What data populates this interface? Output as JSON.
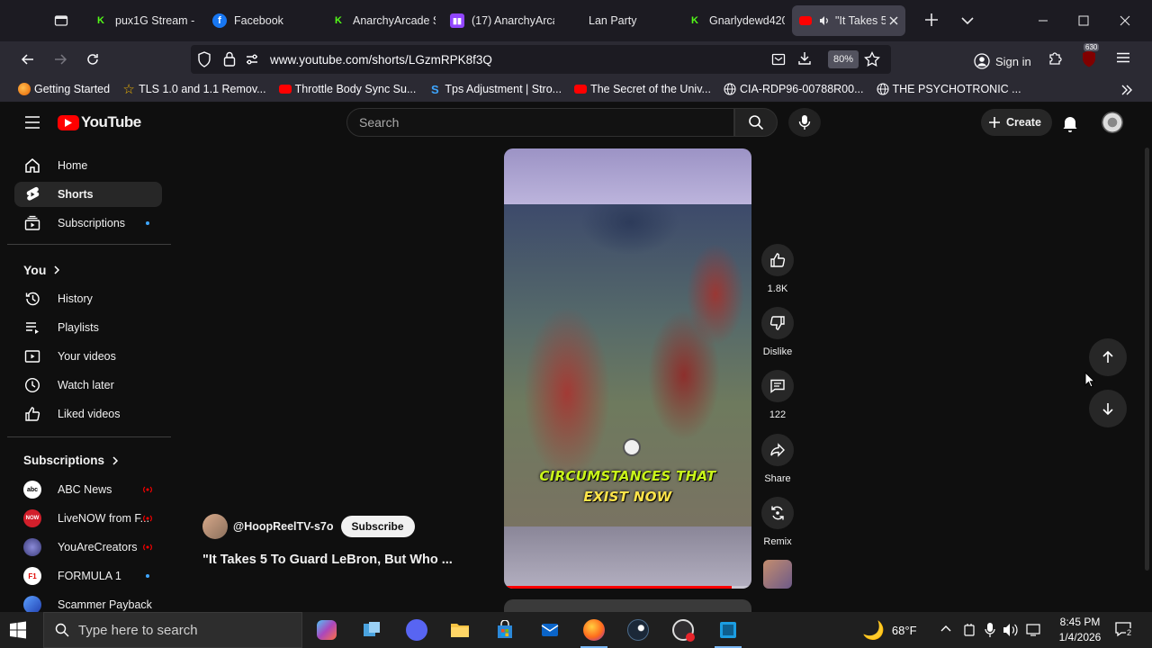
{
  "browser": {
    "tabs": [
      {
        "title": "pux1G Stream - ",
        "favicon": "kick-icon",
        "color": "#53fc18"
      },
      {
        "title": "Facebook",
        "favicon": "facebook-icon",
        "color": "#1877f2"
      },
      {
        "title": "AnarchyArcade S",
        "favicon": "kick-icon",
        "color": "#53fc18"
      },
      {
        "title": "(17) AnarchyArca",
        "favicon": "twitch-icon",
        "color": "#9146ff"
      },
      {
        "title": "Lan Party",
        "favicon": "",
        "color": ""
      },
      {
        "title": "Gnarlydewd420 ",
        "favicon": "kick-icon",
        "color": "#53fc18"
      },
      {
        "title": "\"It Takes 5",
        "favicon": "youtube-icon",
        "color": "#ff0000",
        "active": true
      }
    ],
    "url": "www.youtube.com/shorts/LGzmRPK8f3Q",
    "zoom": "80%",
    "sign_in": "Sign in",
    "extension_badge": "630",
    "bookmarks": [
      {
        "label": "Getting Started",
        "icon": "firefox-icon"
      },
      {
        "label": "TLS 1.0 and 1.1 Remov...",
        "icon": "star-icon"
      },
      {
        "label": "Throttle Body Sync Su...",
        "icon": "youtube-icon"
      },
      {
        "label": "Tps Adjustment | Stro...",
        "icon": "s-icon"
      },
      {
        "label": "The Secret of the Univ...",
        "icon": "youtube-icon"
      },
      {
        "label": "CIA-RDP96-00788R00...",
        "icon": "globe-icon"
      },
      {
        "label": "THE PSYCHOTRONIC ...",
        "icon": "globe-icon"
      }
    ]
  },
  "youtube": {
    "logo_text": "YouTube",
    "search_placeholder": "Search",
    "create_label": "Create",
    "sidebar": {
      "main": [
        {
          "label": "Home",
          "icon": "home-icon"
        },
        {
          "label": "Shorts",
          "icon": "shorts-icon",
          "active": true
        },
        {
          "label": "Subscriptions",
          "icon": "subscriptions-icon",
          "dot": true
        }
      ],
      "you_header": "You",
      "you": [
        {
          "label": "History",
          "icon": "history-icon"
        },
        {
          "label": "Playlists",
          "icon": "playlists-icon"
        },
        {
          "label": "Your videos",
          "icon": "your-videos-icon"
        },
        {
          "label": "Watch later",
          "icon": "watch-later-icon"
        },
        {
          "label": "Liked videos",
          "icon": "liked-videos-icon"
        }
      ],
      "subscriptions_header": "Subscriptions",
      "subscriptions": [
        {
          "label": "ABC News",
          "status": "live",
          "avatar_color": "#ffffff",
          "avatar_text": "abc"
        },
        {
          "label": "LiveNOW from F...",
          "status": "live",
          "avatar_color": "#d21f2b",
          "avatar_text": "NOW"
        },
        {
          "label": "YouAreCreators",
          "status": "live",
          "avatar_color": "#5f5fa8",
          "avatar_text": ""
        },
        {
          "label": "FORMULA 1",
          "status": "dot",
          "avatar_color": "#e10600",
          "avatar_text": "F1"
        },
        {
          "label": "Scammer Payback",
          "status": "",
          "avatar_color": "#3355cc",
          "avatar_text": ""
        }
      ]
    },
    "short": {
      "caption_line1": "CIRCUMSTANCES THAT",
      "caption_line2": "EXIST NOW",
      "progress": 0.92,
      "channel": "@HoopReelTV-s7o",
      "subscribe_label": "Subscribe",
      "title": "\"It Takes 5 To Guard LeBron, But Who ..."
    },
    "actions": {
      "likes": "1.8K",
      "dislike": "Dislike",
      "comments": "122",
      "share": "Share",
      "remix": "Remix"
    }
  },
  "taskbar": {
    "search_placeholder": "Type here to search",
    "weather": "68°F",
    "time": "8:45 PM",
    "date": "1/4/2026",
    "notification_count": "2"
  }
}
